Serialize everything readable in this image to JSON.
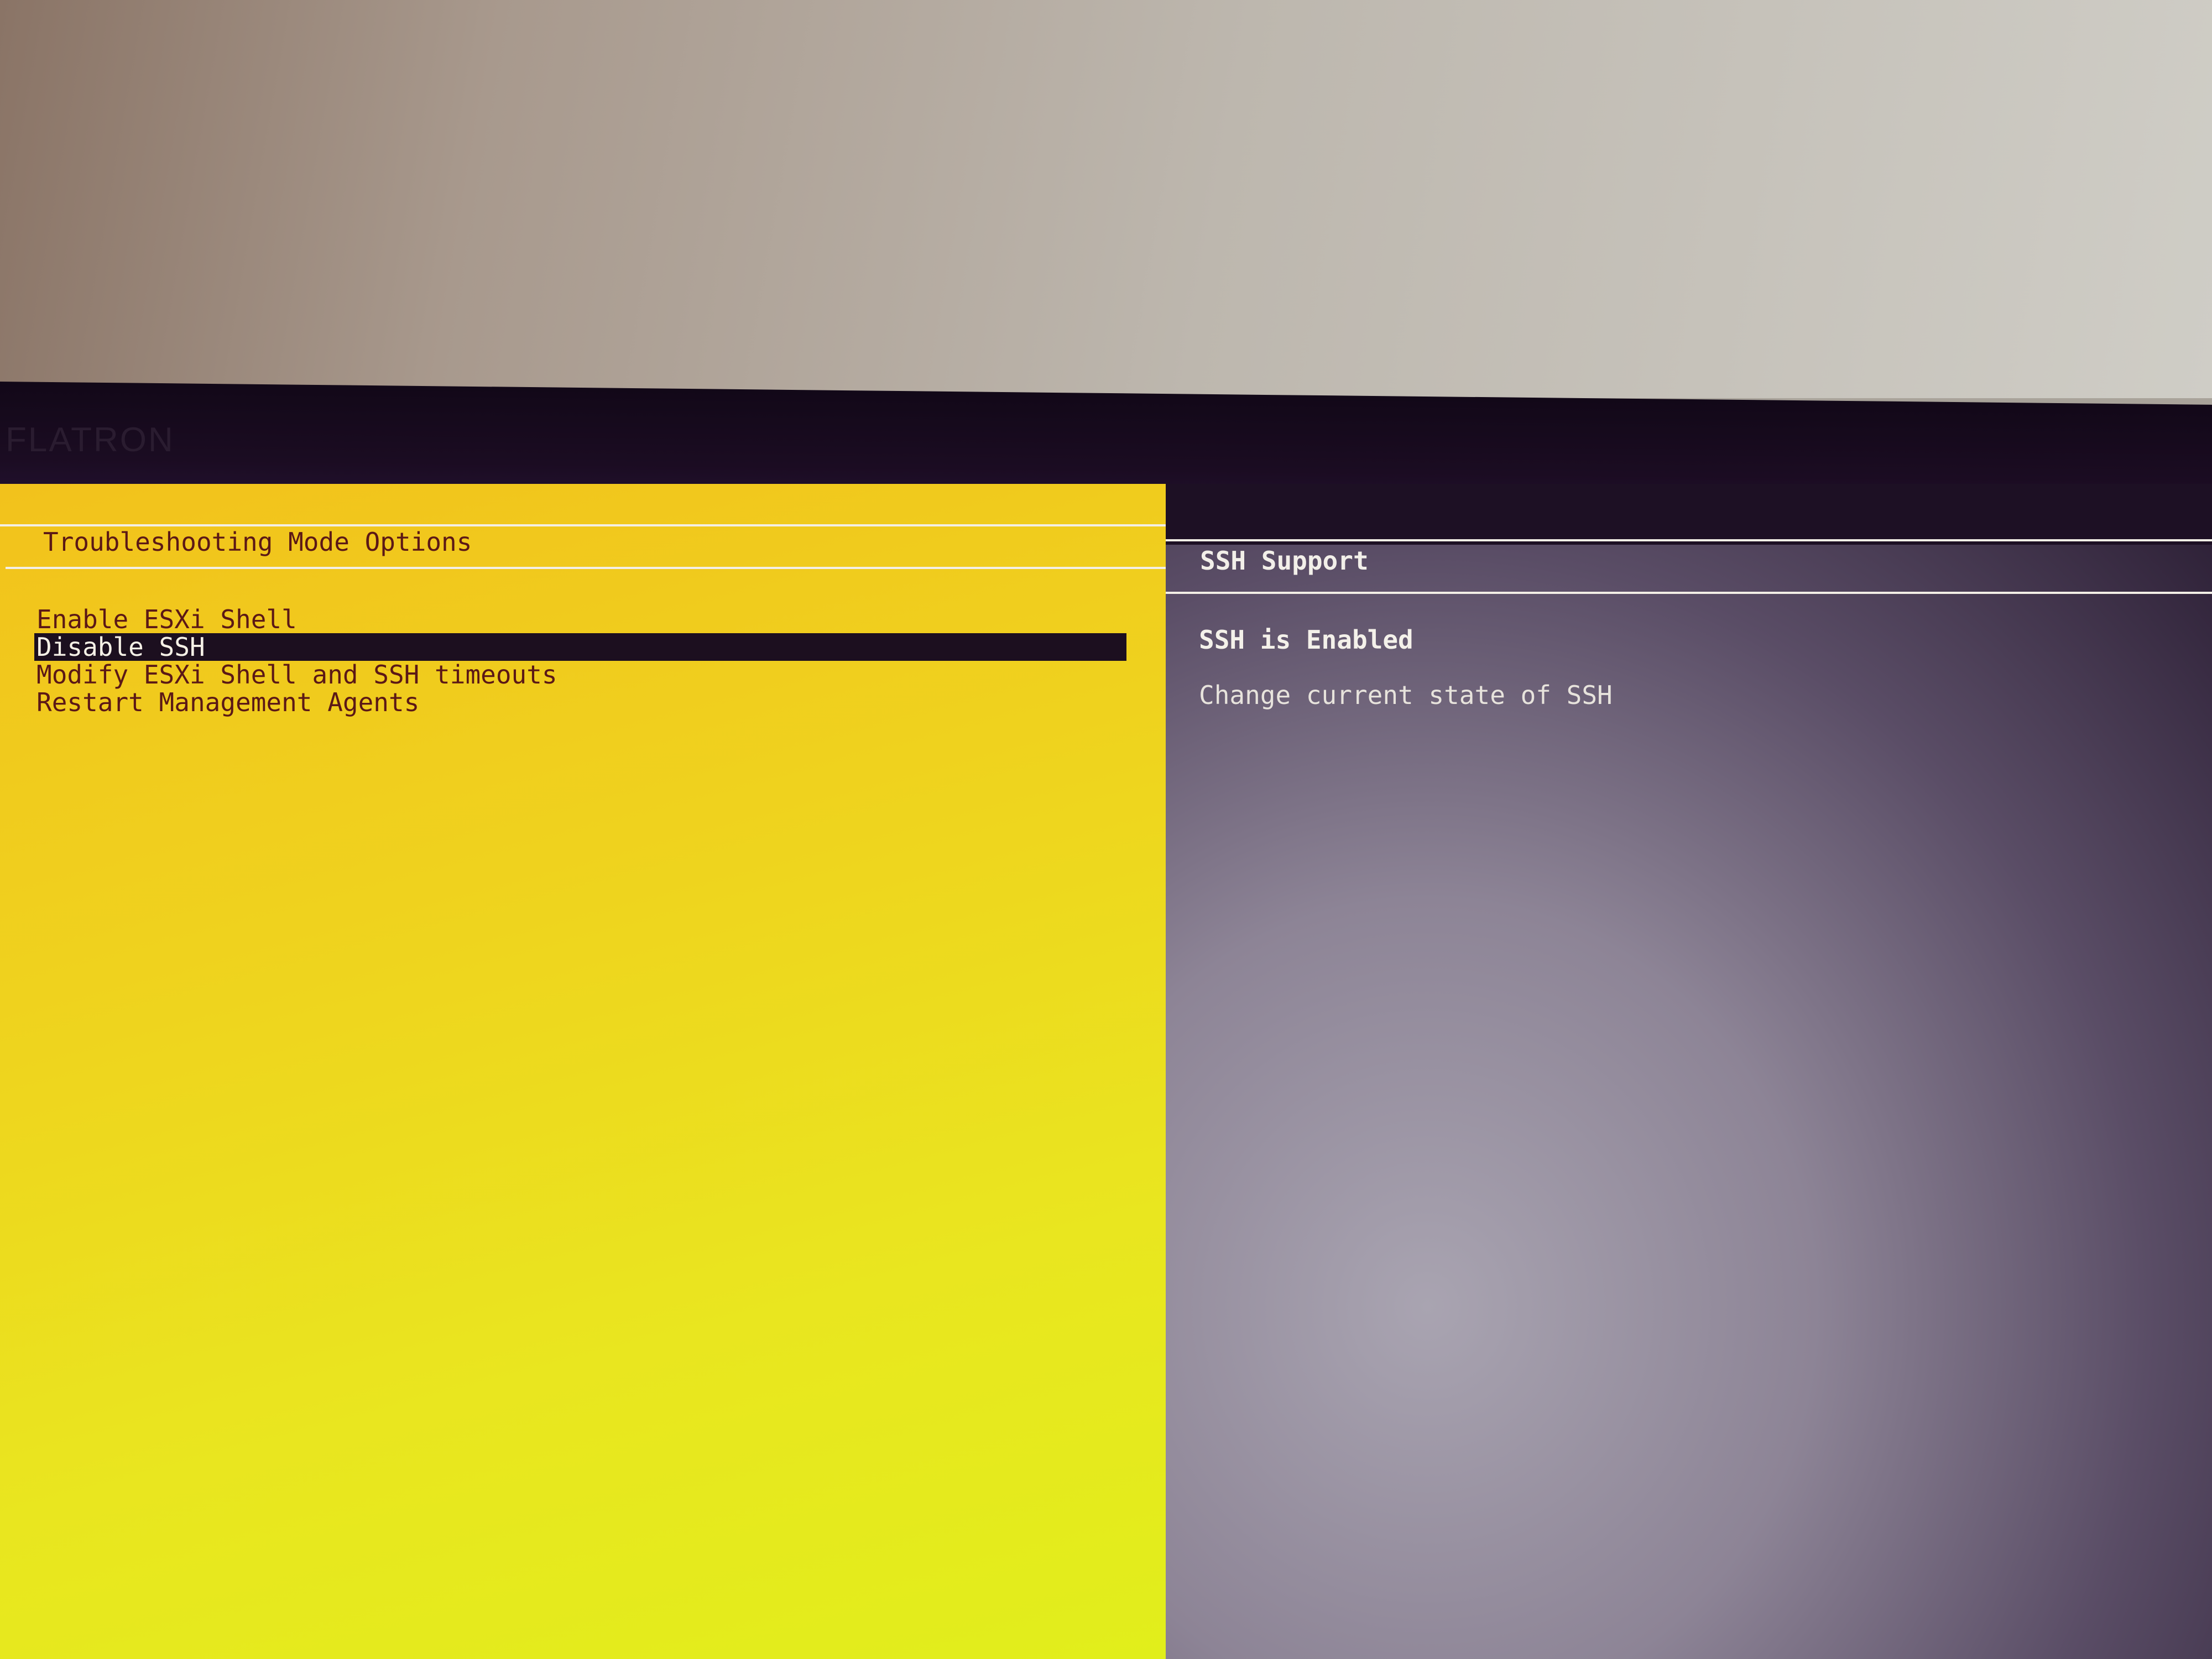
{
  "monitor": {
    "brand": "FLATRON"
  },
  "left_pane": {
    "title": "Troubleshooting Mode Options",
    "items": [
      {
        "label": "Enable ESXi Shell",
        "selected": false
      },
      {
        "label": "Disable SSH",
        "selected": true
      },
      {
        "label": "Modify ESXi Shell and SSH timeouts",
        "selected": false
      },
      {
        "label": "Restart Management Agents",
        "selected": false
      }
    ]
  },
  "right_pane": {
    "title": "SSH Support",
    "status": "SSH is Enabled",
    "description": "Change current state of SSH"
  },
  "colors": {
    "left_background": "#efd21e",
    "left_text": "#5b1816",
    "right_background": "#2a1d33",
    "right_text": "#f4f1ea",
    "selection_bar": "#1c0f1f"
  }
}
